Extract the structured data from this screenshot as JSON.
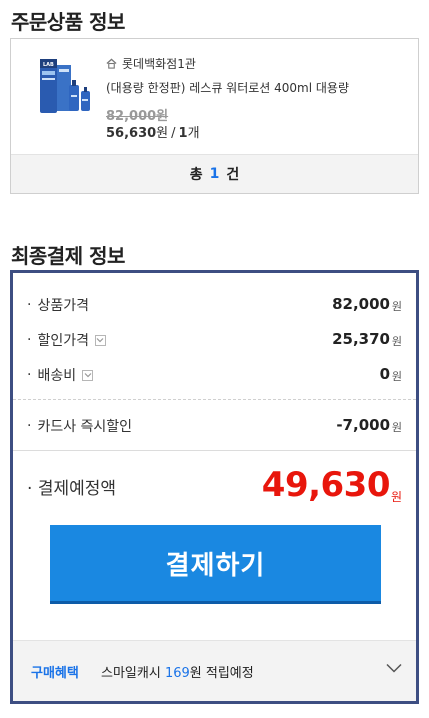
{
  "order_section": {
    "title": "주문상품 정보",
    "store": "롯데백화점1관",
    "product_name": "(대용량 한정판) 레스큐 워터로션 400ml 대용량",
    "original_price": "82,000원",
    "sale_price": "56,630",
    "price_unit": "원",
    "quantity": "1",
    "quantity_unit": "개",
    "total_prefix": "총",
    "total_count": "1",
    "total_suffix": "건",
    "product_image_brand": "LAB"
  },
  "payment_section": {
    "title": "최종결제 정보",
    "rows": [
      {
        "label": "상품가격",
        "value": "82,000",
        "unit": "원"
      },
      {
        "label": "할인가격",
        "value": "25,370",
        "unit": "원"
      },
      {
        "label": "배송비",
        "value": "0",
        "unit": "원"
      },
      {
        "label": "카드사 즉시할인",
        "value": "-7,000",
        "unit": "원"
      }
    ],
    "final_label": "결제예정액",
    "final_value": "49,630",
    "final_unit": "원",
    "pay_button": "결제하기",
    "benefit_label": "구매혜택",
    "benefit_prefix": "스마일캐시",
    "benefit_points": "169",
    "benefit_suffix": "원 적립예정"
  },
  "colors": {
    "accent_blue": "#1a73e8",
    "pay_button": "#1a88e1",
    "final_price": "#e8160c",
    "box_border": "#3d4e82"
  }
}
